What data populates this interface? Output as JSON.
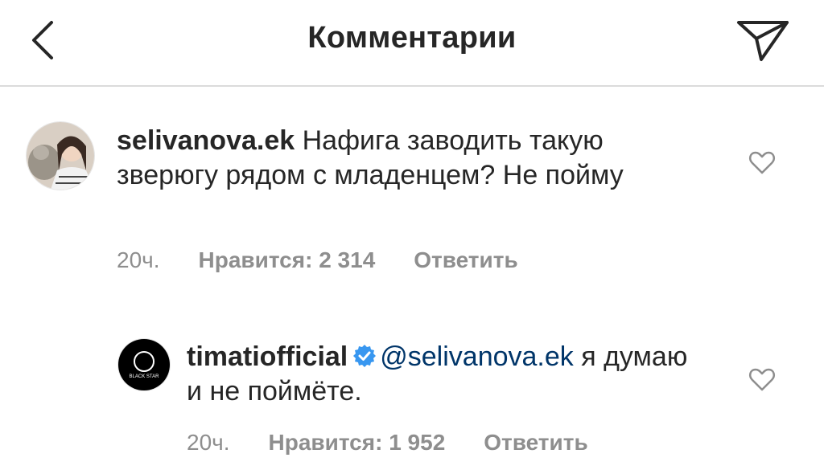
{
  "header": {
    "title": "Комментарии",
    "back_icon": "chevron-left-icon",
    "share_icon": "paper-plane-icon"
  },
  "comments": [
    {
      "username": "selivanova.ek",
      "text": "Нафига заводить такую зверюгу рядом с младенцем? Не пойму",
      "time": "20ч.",
      "likes": "Нравится: 2 314",
      "reply": "Ответить",
      "avatar_icon": "user-avatar-photo",
      "like_icon": "heart-outline-icon"
    },
    {
      "username": "timatiofficial",
      "verified": true,
      "mention": "@selivanova.ek",
      "text": "я думаю и не поймёте.",
      "time": "20ч.",
      "likes": "Нравится: 1 952",
      "reply": "Ответить",
      "avatar_icon": "black-star-logo",
      "avatar_text": "BLACK STAR",
      "like_icon": "heart-outline-icon"
    }
  ],
  "colors": {
    "text": "#262626",
    "secondary": "#8e8e8e",
    "mention": "#003569",
    "verified": "#3897f0",
    "divider": "#dbdbdb"
  }
}
